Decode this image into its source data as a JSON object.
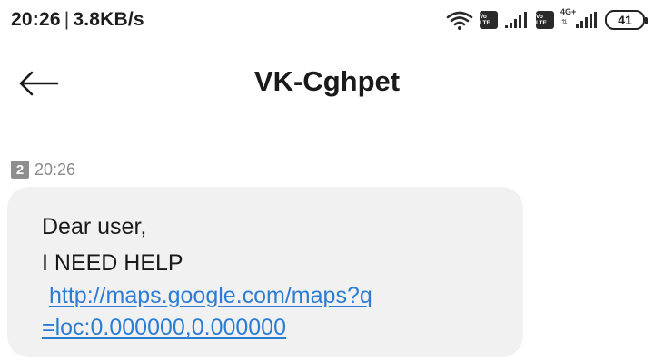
{
  "status_bar": {
    "time": "20:26",
    "separator": "|",
    "network_speed": "3.8KB/s",
    "volte_label": "Vo LTE",
    "network_type": "4G+",
    "battery_level": "41",
    "icons": [
      "wifi-icon",
      "volte-icon",
      "signal-icon",
      "volte-icon",
      "signal-icon",
      "battery-icon"
    ]
  },
  "header": {
    "title": "VK-Cghpet",
    "back_icon": "arrow-left-icon"
  },
  "message": {
    "sim_slot": "2",
    "time": "20:26",
    "lines": [
      "Dear user,",
      "I NEED HELP"
    ],
    "link_lines": [
      "http://maps.google.com/maps?q",
      "=loc:0.000000,0.000000"
    ]
  },
  "colors": {
    "bubble": "#f1f1f1",
    "link": "#2b7dd4",
    "meta_text": "#8a8a8a",
    "sim_badge": "#8e8e8e"
  }
}
